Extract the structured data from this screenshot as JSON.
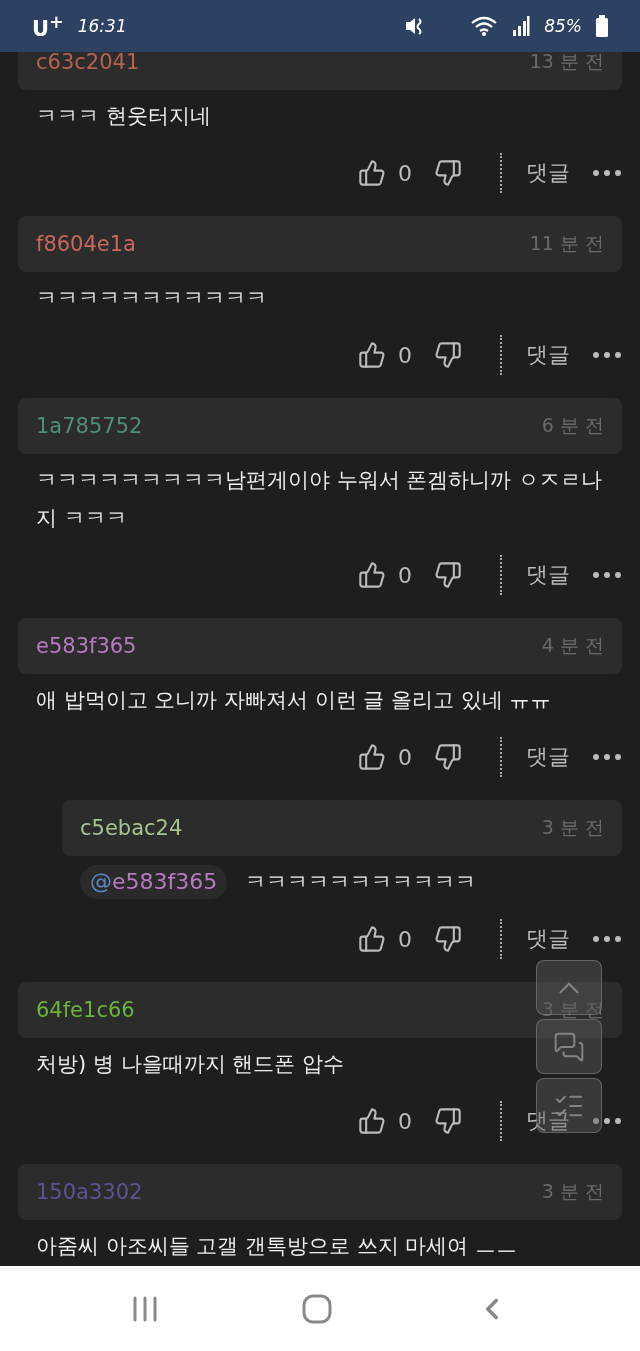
{
  "status_bar": {
    "carrier": "U$^{+}$",
    "time": "16:31",
    "battery": "85%"
  },
  "comments": [
    {
      "kind": "comment",
      "user": "c63c2041",
      "color": "#b5624f",
      "time": "13 분 전",
      "body": "ㅋㅋㅋ 현웃터지네",
      "likes": "0",
      "reply_label": "댓글"
    },
    {
      "kind": "comment",
      "user": "f8604e1a",
      "color": "#c9685a",
      "time": "11 분 전",
      "body": "ㅋㅋㅋㅋㅋㅋㅋㅋㅋㅋㅋ",
      "likes": "0",
      "reply_label": "댓글"
    },
    {
      "kind": "comment",
      "user": "1a785752",
      "color": "#4f8f72",
      "time": "6 분 전",
      "body": "ㅋㅋㅋㅋㅋㅋㅋㅋㅋ남편게이야 누워서 폰겜하니까 ㅇㅈㄹ나지 ㅋㅋㅋ",
      "likes": "0",
      "reply_label": "댓글"
    },
    {
      "kind": "comment",
      "user": "e583f365",
      "color": "#b77ac0",
      "time": "4 분 전",
      "body": "애 밥먹이고 오니까 자빠져서 이런 글 올리고 있네 ㅠㅠ",
      "likes": "0",
      "reply_label": "댓글"
    },
    {
      "kind": "reply",
      "user": "c5ebac24",
      "color": "#a6c48f",
      "time": "3 분 전",
      "mention_prefix": "@",
      "mention": "e583f365",
      "body": "ㅋㅋㅋㅋㅋㅋㅋㅋㅋㅋㅋ",
      "likes": "0",
      "reply_label": "댓글"
    },
    {
      "kind": "comment",
      "user": "64fe1c66",
      "color": "#6cb33a",
      "time": "3 분 전",
      "body": "처방) 병 나을때까지 핸드폰 압수",
      "likes": "0",
      "reply_label": "댓글"
    },
    {
      "kind": "comment",
      "user": "150a3302",
      "color": "#5a5490",
      "time": "3 분 전",
      "body": "아줌씨 아조씨들 고갤 갠톡방으로 쓰지 마세여 ㅡㅡ"
    }
  ]
}
